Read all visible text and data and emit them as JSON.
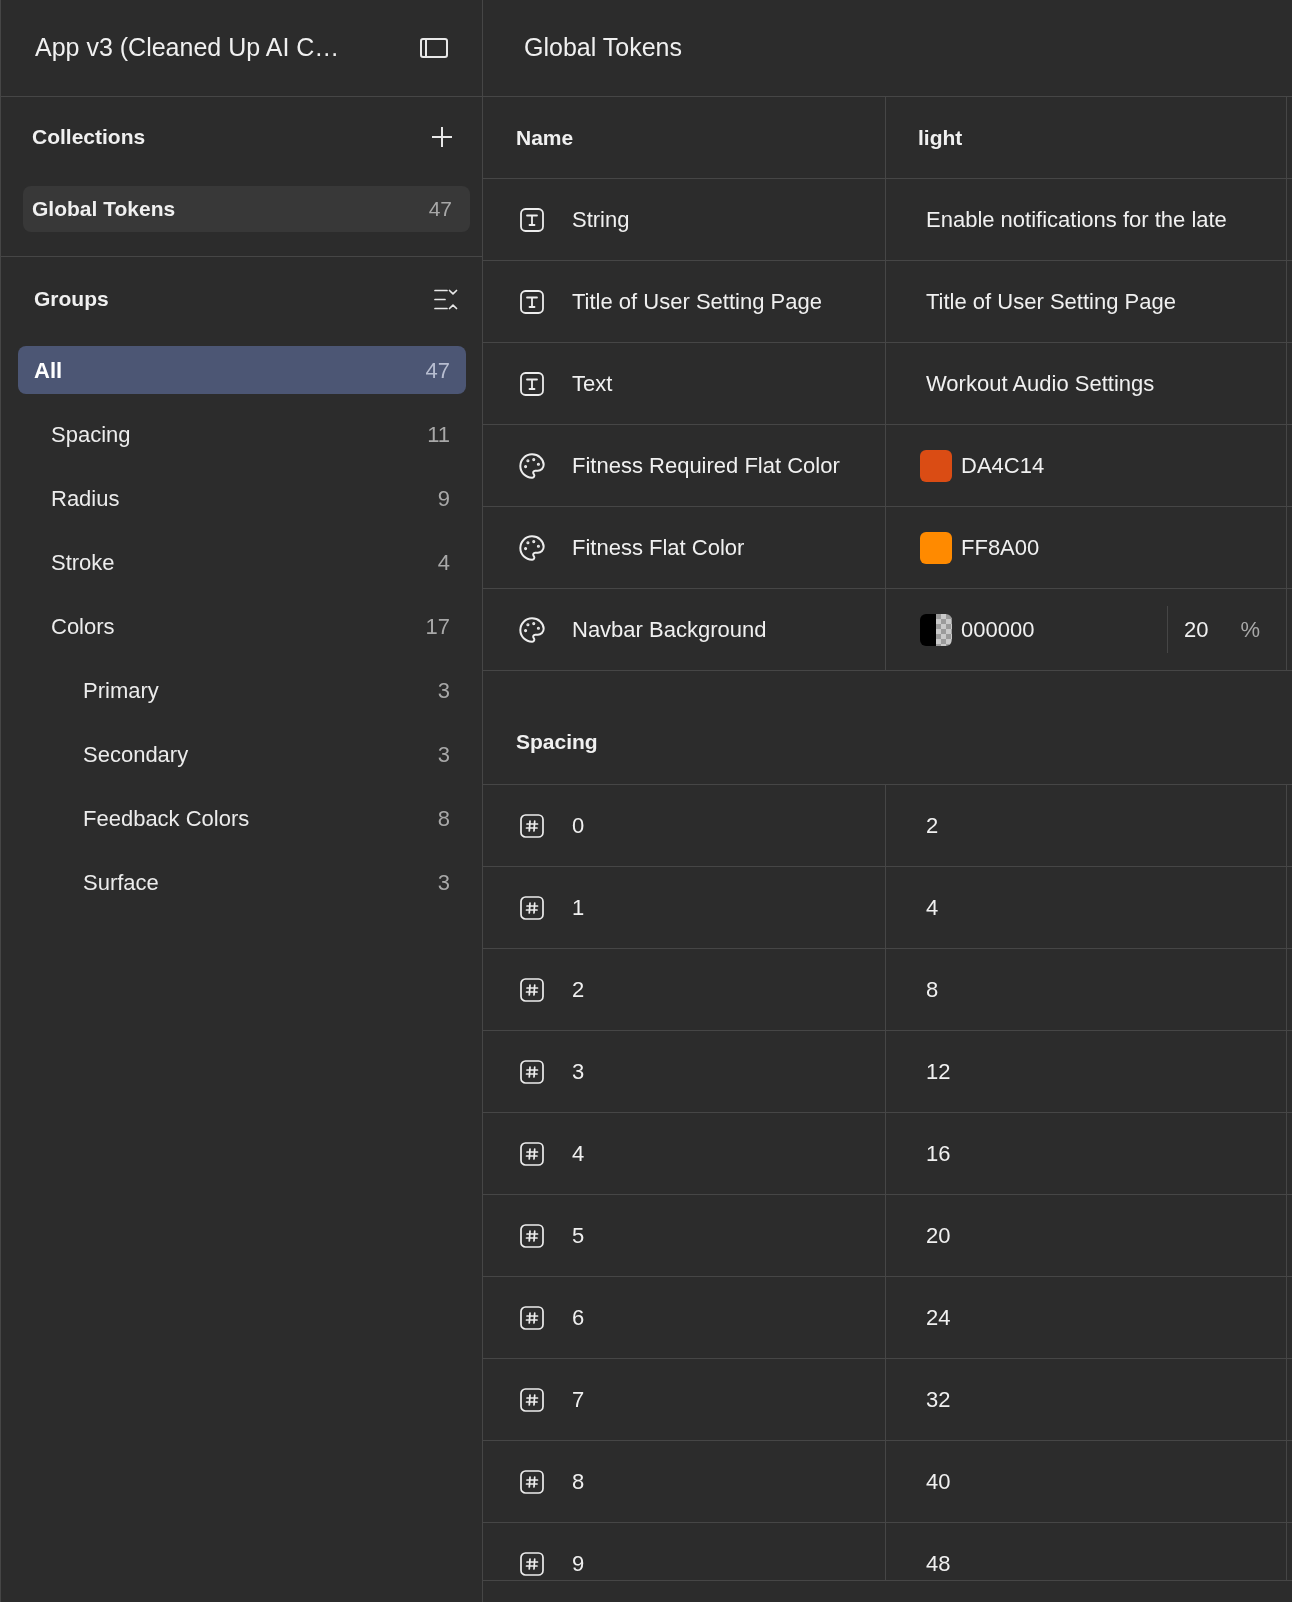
{
  "sidebar": {
    "title": "App v3 (Cleaned Up AI C…",
    "collections": {
      "heading": "Collections",
      "items": [
        {
          "label": "Global Tokens",
          "count": "47",
          "selected": true
        }
      ]
    },
    "groups": {
      "heading": "Groups",
      "items": [
        {
          "label": "All",
          "count": "47",
          "selected": true,
          "children": [
            {
              "label": "Spacing",
              "count": "11",
              "selected": false
            },
            {
              "label": "Radius",
              "count": "9",
              "selected": false
            },
            {
              "label": "Stroke",
              "count": "4",
              "selected": false
            },
            {
              "label": "Colors",
              "count": "17",
              "selected": false,
              "children": [
                {
                  "label": "Primary",
                  "count": "3",
                  "selected": false
                },
                {
                  "label": "Secondary",
                  "count": "3",
                  "selected": false
                },
                {
                  "label": "Feedback Colors",
                  "count": "8",
                  "selected": false
                },
                {
                  "label": "Surface",
                  "count": "3",
                  "selected": false
                }
              ]
            }
          ]
        }
      ]
    }
  },
  "header": {
    "title": "Global Tokens"
  },
  "table": {
    "columns": [
      "Name",
      "light"
    ],
    "rows": [
      {
        "kind": "string",
        "name": "String",
        "value": "Enable notifications for the late"
      },
      {
        "kind": "string",
        "name": "Title of User Setting Page",
        "value": "Title of User Setting Page"
      },
      {
        "kind": "string",
        "name": "Text",
        "value": "Workout Audio Settings"
      },
      {
        "kind": "color",
        "name": "Fitness Required Flat Color",
        "value": "DA4C14",
        "color": "#da4c14"
      },
      {
        "kind": "color",
        "name": "Fitness Flat Color",
        "value": "FF8A00",
        "color": "#ff8a00"
      },
      {
        "kind": "color",
        "name": "Navbar Background",
        "value": "000000",
        "color": "#000000",
        "opacity": "20",
        "unit": "%"
      }
    ]
  },
  "sections": [
    {
      "title": "Spacing",
      "rows": [
        {
          "kind": "number",
          "name": "0",
          "value": "2"
        },
        {
          "kind": "number",
          "name": "1",
          "value": "4"
        },
        {
          "kind": "number",
          "name": "2",
          "value": "8"
        },
        {
          "kind": "number",
          "name": "3",
          "value": "12"
        },
        {
          "kind": "number",
          "name": "4",
          "value": "16"
        },
        {
          "kind": "number",
          "name": "5",
          "value": "20"
        },
        {
          "kind": "number",
          "name": "6",
          "value": "24"
        },
        {
          "kind": "number",
          "name": "7",
          "value": "32"
        },
        {
          "kind": "number",
          "name": "8",
          "value": "40"
        },
        {
          "kind": "number",
          "name": "9",
          "value": "48"
        }
      ]
    }
  ]
}
